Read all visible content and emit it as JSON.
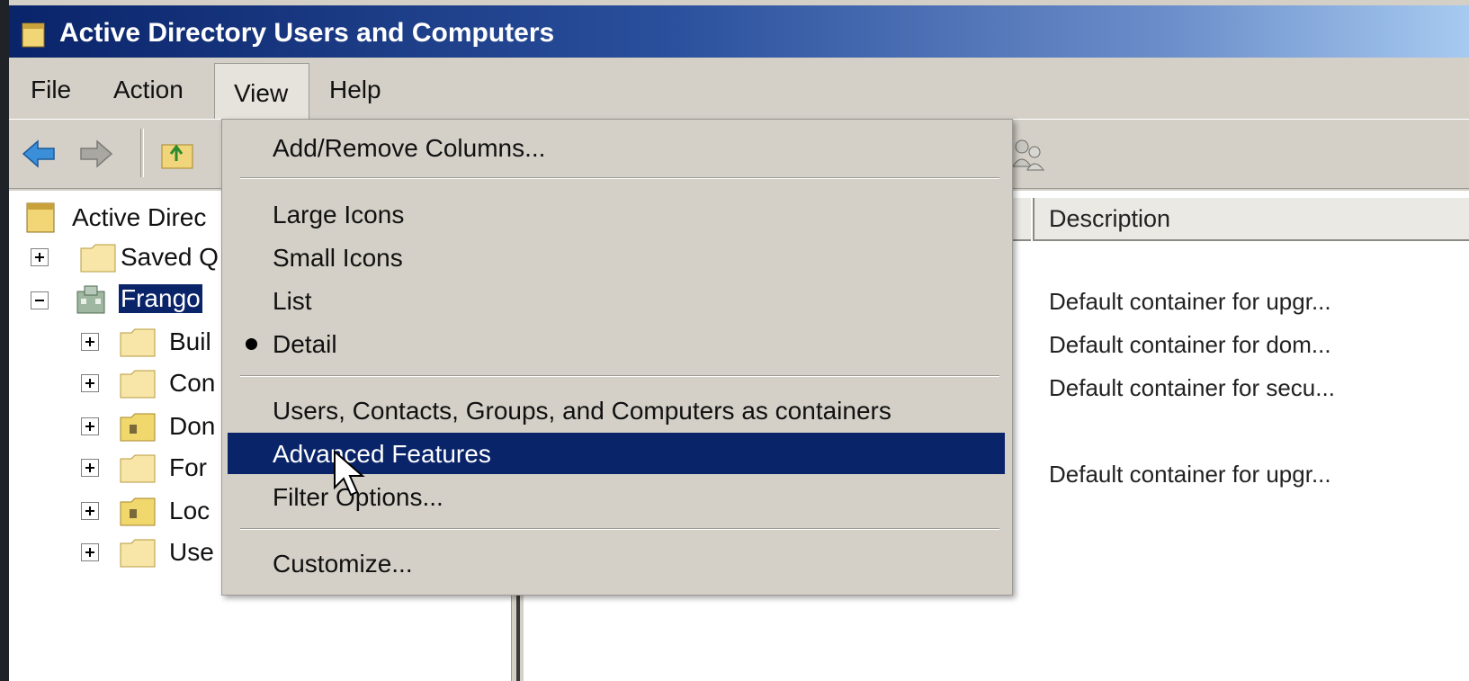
{
  "window": {
    "title": "Active Directory Users and Computers"
  },
  "menubar": {
    "items": [
      "File",
      "Action",
      "View",
      "Help"
    ]
  },
  "toolbar": {
    "buttons": [
      {
        "name": "back",
        "icon": "back-arrow-icon"
      },
      {
        "name": "forward",
        "icon": "forward-arrow-icon"
      },
      {
        "name": "up",
        "icon": "up-folder-icon"
      },
      {
        "name": "delegate",
        "icon": "users-icon"
      }
    ]
  },
  "tree": {
    "root": "Active Direc",
    "items": [
      {
        "label": "Saved Q",
        "expander": "plus",
        "icon": "folder-icon"
      },
      {
        "label": "Frango",
        "expander": "minus",
        "icon": "domain-icon",
        "selected": true
      },
      {
        "label": "Buil",
        "expander": "plus",
        "icon": "folder-icon"
      },
      {
        "label": "Con",
        "expander": "plus",
        "icon": "folder-icon"
      },
      {
        "label": "Don",
        "expander": "plus",
        "icon": "ou-icon"
      },
      {
        "label": "For",
        "expander": "plus",
        "icon": "folder-icon"
      },
      {
        "label": "Loc",
        "expander": "plus",
        "icon": "ou-icon"
      },
      {
        "label": "Use",
        "expander": "plus",
        "icon": "folder-icon"
      }
    ]
  },
  "details": {
    "columns": [
      "Description"
    ],
    "rows": [
      "Default container for upgr...",
      "Default container for dom...",
      "Default container for secu...",
      "",
      "Default container for upgr..."
    ]
  },
  "view_menu": {
    "items": [
      {
        "label": "Add/Remove Columns...",
        "checked": false,
        "highlighted": false
      },
      {
        "separator": true
      },
      {
        "label": "Large Icons",
        "checked": false,
        "highlighted": false
      },
      {
        "label": "Small Icons",
        "checked": false,
        "highlighted": false
      },
      {
        "label": "List",
        "checked": false,
        "highlighted": false
      },
      {
        "label": "Detail",
        "checked": true,
        "highlighted": false
      },
      {
        "separator": true
      },
      {
        "label": "Users, Contacts, Groups, and Computers as containers",
        "checked": false,
        "highlighted": false
      },
      {
        "label": "Advanced Features",
        "checked": false,
        "highlighted": true
      },
      {
        "label": "Filter Options...",
        "checked": false,
        "highlighted": false
      },
      {
        "separator": true
      },
      {
        "label": "Customize...",
        "checked": false,
        "highlighted": false
      }
    ]
  },
  "colors": {
    "titlebar_start": "#0a246a",
    "titlebar_end": "#a6caf0",
    "highlight": "#0a246a",
    "chrome": "#d4d0c8"
  }
}
